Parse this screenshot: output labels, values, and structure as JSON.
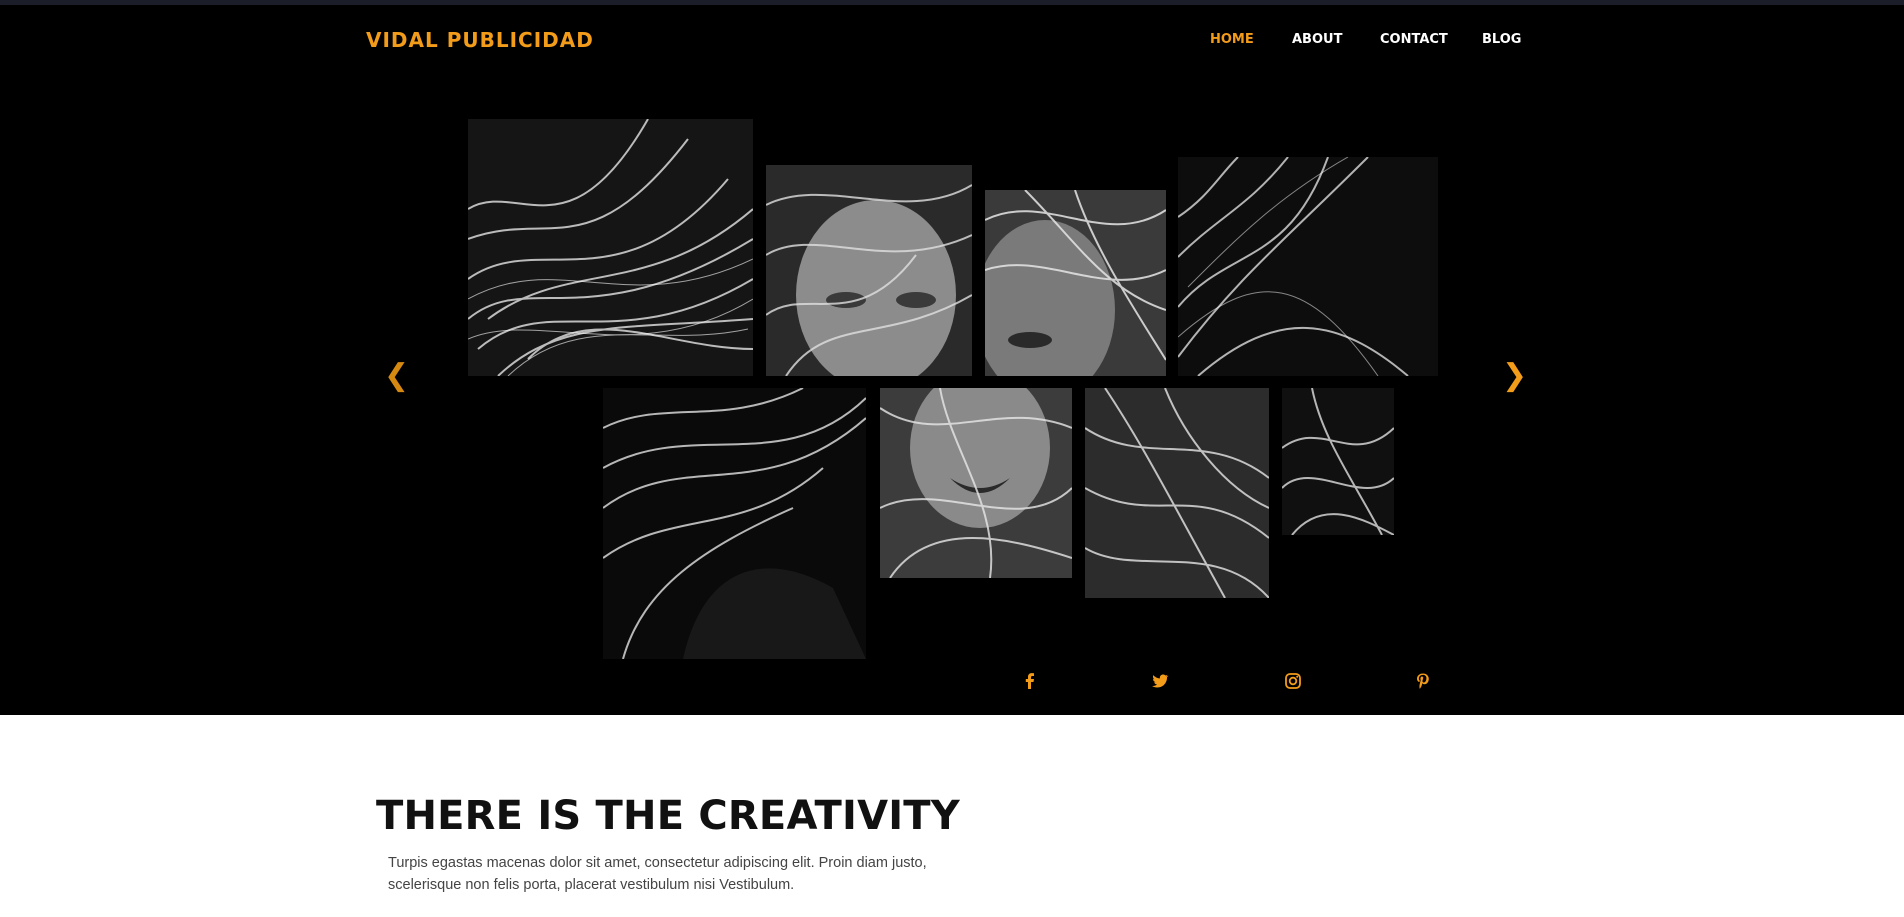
{
  "brand": {
    "name": "VIDAL PUBLICIDAD",
    "accent_color": "#f39c1a"
  },
  "nav": {
    "items": [
      {
        "label": "HOME",
        "active": true
      },
      {
        "label": "ABOUT",
        "active": false
      },
      {
        "label": "CONTACT",
        "active": false
      },
      {
        "label": "BLOG",
        "active": false
      }
    ]
  },
  "hero": {
    "background": "#000000",
    "gallery": {
      "photo_subject": "black-and-white photo of a woman with windswept hair",
      "tile_count": 9
    },
    "prev_icon": "chevron-left-icon",
    "next_icon": "chevron-right-icon",
    "prev_glyph": "❮",
    "next_glyph": "❯"
  },
  "social": {
    "icons": [
      "facebook-icon",
      "twitter-icon",
      "instagram-icon",
      "pinterest-icon"
    ]
  },
  "content": {
    "title": "THERE IS THE CREATIVITY",
    "text": "Turpis egastas macenas dolor sit amet, consectetur adipiscing elit. Proin diam justo, scelerisque non felis porta, placerat vestibulum nisi Vestibulum."
  }
}
